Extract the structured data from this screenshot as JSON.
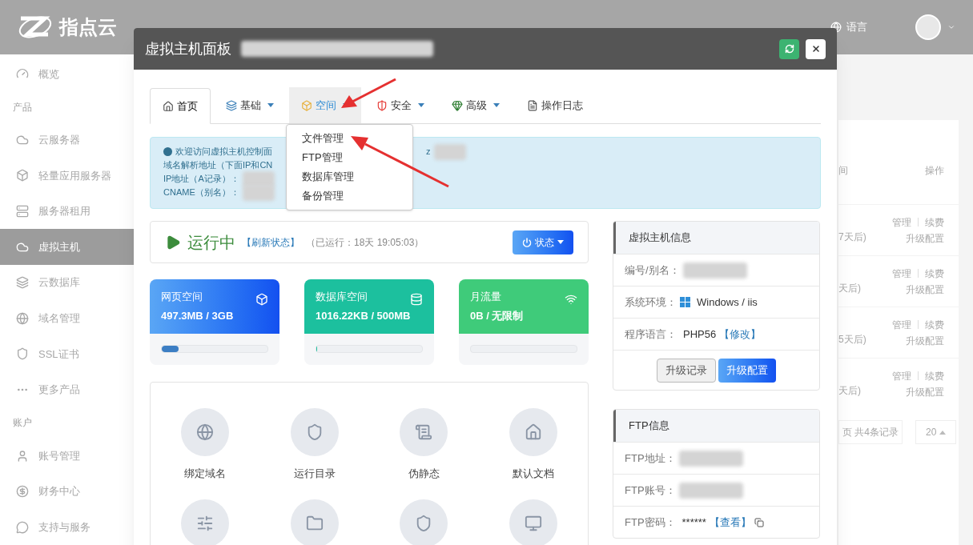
{
  "header": {
    "logo": "指点云",
    "nav": [
      {
        "label": "语言"
      }
    ]
  },
  "sidebar": {
    "items": [
      {
        "kind": "item",
        "label": "概览",
        "selected": false
      },
      {
        "kind": "section",
        "label": "产品"
      },
      {
        "kind": "item",
        "label": "云服务器",
        "selected": false
      },
      {
        "kind": "item",
        "label": "轻量应用服务器",
        "selected": false
      },
      {
        "kind": "item",
        "label": "服务器租用",
        "selected": false
      },
      {
        "kind": "item",
        "label": "虚拟主机",
        "selected": true
      },
      {
        "kind": "item",
        "label": "云数据库",
        "selected": false
      },
      {
        "kind": "item",
        "label": "域名管理",
        "selected": false
      },
      {
        "kind": "item",
        "label": "SSL证书",
        "selected": false
      },
      {
        "kind": "item",
        "label": "更多产品",
        "selected": false
      },
      {
        "kind": "section",
        "label": "账户"
      },
      {
        "kind": "item",
        "label": "账号管理",
        "selected": false
      },
      {
        "kind": "item",
        "label": "财务中心",
        "selected": false
      },
      {
        "kind": "item",
        "label": "支持与服务",
        "selected": false
      }
    ]
  },
  "background_table": {
    "column_partial": "间",
    "action_heading": "操作",
    "rows": [
      {
        "expiry": "7天后)",
        "manage": "管理",
        "renew": "续费",
        "upgrade": "升级配置"
      },
      {
        "expiry": "天后)",
        "manage": "管理",
        "renew": "续费",
        "upgrade": "升级配置"
      },
      {
        "expiry": "5天后)",
        "manage": "管理",
        "renew": "续费",
        "upgrade": "升级配置"
      },
      {
        "expiry": "天后)",
        "manage": "管理",
        "renew": "续费",
        "upgrade": "升级配置"
      }
    ],
    "pager": {
      "summary": "页 共4条记录",
      "page_size": "20"
    }
  },
  "modal": {
    "title": "虚拟主机面板",
    "tabs": [
      {
        "label": "首页",
        "selected": true,
        "dropdown": false,
        "expanded": false
      },
      {
        "label": "基础",
        "selected": false,
        "dropdown": true,
        "expanded": false
      },
      {
        "label": "空间",
        "selected": false,
        "dropdown": true,
        "expanded": true
      },
      {
        "label": "安全",
        "selected": false,
        "dropdown": true,
        "expanded": false
      },
      {
        "label": "高级",
        "selected": false,
        "dropdown": true,
        "expanded": false
      },
      {
        "label": "操作日志",
        "selected": false,
        "dropdown": false,
        "expanded": false
      }
    ],
    "menu": [
      {
        "label": "文件管理"
      },
      {
        "label": "FTP管理"
      },
      {
        "label": "数据库管理"
      },
      {
        "label": "备份管理"
      }
    ],
    "notice": {
      "lines": [
        "欢迎访问虚拟主机控制面",
        "域名解析地址（下面IP和CN",
        "IP地址（A记录）：",
        "CNAME（别名）："
      ],
      "tail": "z"
    },
    "status": {
      "state": "运行中",
      "refresh": "【刷新状态】",
      "uptime": "（已运行：18天 19:05:03）",
      "button": "状态"
    },
    "stats": [
      {
        "kind": "web",
        "title": "网页空间",
        "value": "497.3MB / 3GB",
        "level": 0.16
      },
      {
        "kind": "database",
        "title": "数据库空间",
        "value": "1016.22KB / 500MB",
        "level": 0.005
      },
      {
        "kind": "traffic",
        "title": "月流量",
        "value": "0B / 无限制",
        "level": 0
      }
    ],
    "functions": [
      {
        "label": "绑定域名"
      },
      {
        "label": "运行目录"
      },
      {
        "label": "伪静态"
      },
      {
        "label": "默认文档"
      }
    ],
    "host_info": {
      "title": "虚拟主机信息",
      "rows": [
        {
          "kind": "redacted",
          "label": "编号/别名："
        },
        {
          "kind": "os",
          "label": "系统环境：",
          "value": "Windows / iis"
        },
        {
          "kind": "link",
          "label": "程序语言：",
          "value": "PHP56",
          "link": "【修改】"
        }
      ],
      "buttons": [
        {
          "label": "升级记录",
          "primary": false
        },
        {
          "label": "升级配置",
          "primary": true
        }
      ]
    },
    "ftp_info": {
      "title": "FTP信息",
      "rows": [
        {
          "kind": "redacted",
          "label": "FTP地址："
        },
        {
          "kind": "redacted",
          "label": "FTP账号："
        },
        {
          "kind": "password",
          "label": "FTP密码：",
          "value": "******",
          "link": "【查看】"
        }
      ]
    }
  }
}
